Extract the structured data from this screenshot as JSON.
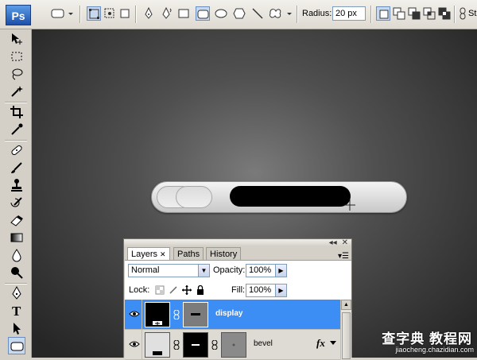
{
  "app": {
    "logo": "Ps"
  },
  "options_bar": {
    "tool_preset_icon": "rounded-rectangle-icon",
    "shape_tools": [
      "pen-icon",
      "freeform-pen-icon",
      "rectangle-icon",
      "rounded-rectangle-icon",
      "ellipse-icon",
      "polygon-icon",
      "line-icon",
      "custom-shape-icon"
    ],
    "radius_label": "Radius:",
    "radius_value": "20 px",
    "style_label": "St"
  },
  "toolbox": {
    "tools": [
      "move-icon",
      "marquee-icon",
      "lasso-icon",
      "magic-wand-icon",
      "crop-icon",
      "eyedropper-icon",
      "healing-icon",
      "brush-icon",
      "stamp-icon",
      "history-brush-icon",
      "eraser-icon",
      "gradient-icon",
      "blur-icon",
      "dodge-icon",
      "pen-icon",
      "type-icon",
      "path-selection-icon",
      "shape-icon"
    ],
    "type_tool_glyph": "T"
  },
  "layers_panel": {
    "tabs": [
      {
        "label": "Layers",
        "active": true
      },
      {
        "label": "Paths",
        "active": false
      },
      {
        "label": "History",
        "active": false
      }
    ],
    "blend_mode": "Normal",
    "opacity_label": "Opacity:",
    "opacity_value": "100%",
    "lock_label": "Lock:",
    "fill_label": "Fill:",
    "fill_value": "100%",
    "layers": [
      {
        "name": "display",
        "selected": true,
        "fx": false
      },
      {
        "name": "bevel",
        "selected": false,
        "fx": true,
        "fx_label": "fx"
      }
    ]
  },
  "watermark": {
    "main": "查字典 教程网",
    "url": "jiaocheng.chazidian.com"
  },
  "colors": {
    "selection_blue": "#3d8ef4",
    "canvas_dark": "#262626",
    "active_tool": "#c8d9ef"
  }
}
